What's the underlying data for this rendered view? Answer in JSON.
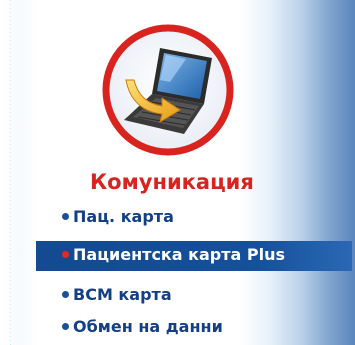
{
  "section_title": "Комуникация",
  "logo": {
    "icon": "laptop-communication-icon",
    "colors": {
      "ring": "#d8231e",
      "arrow": "#f2b31c",
      "laptop": "#2b2b2b"
    }
  },
  "menu": {
    "items": [
      {
        "label": "Пац. карта",
        "active": false
      },
      {
        "label": "Пациентска карта Plus",
        "active": true
      },
      {
        "label": "BCM карта",
        "active": false
      },
      {
        "label": "Обмен на данни",
        "active": false
      }
    ]
  },
  "colors": {
    "title": "#d8231e",
    "link": "#123f86",
    "active_bg": "#15509b",
    "active_text": "#ffffff",
    "active_bullet": "#e12a24"
  }
}
